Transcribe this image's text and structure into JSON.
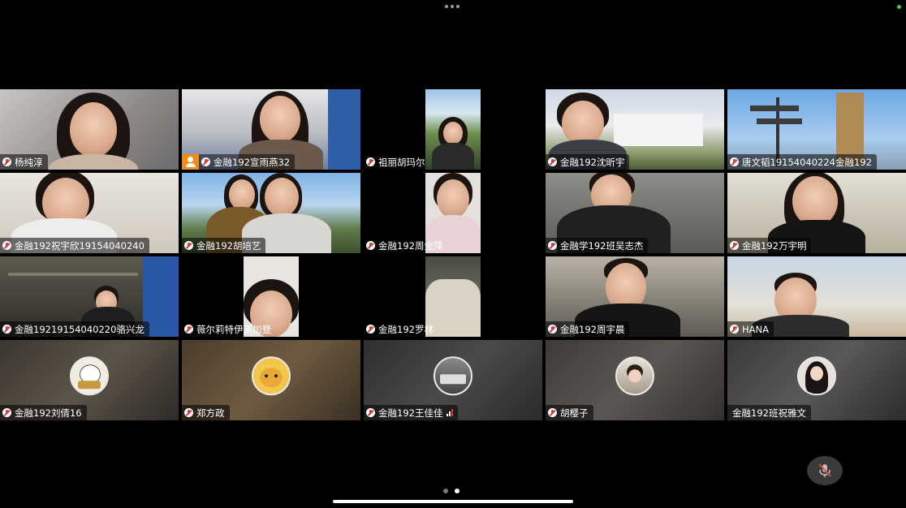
{
  "colors": {
    "background": "#000000",
    "host_badge": "#f08c1a",
    "mic_muted": "#d23b3b",
    "status": "#3ccf4e"
  },
  "participants": [
    {
      "name": "杨纯淳",
      "mic_icon": "muted-mic-icon"
    },
    {
      "name": "金融192宣雨燕32",
      "mic_icon": "muted-mic-icon",
      "host": true
    },
    {
      "name": "祖丽胡玛尔",
      "mic_icon": "muted-mic-icon"
    },
    {
      "name": "金融192沈昕宇",
      "mic_icon": "muted-mic-icon"
    },
    {
      "name": "唐文韬19154040224金融192",
      "mic_icon": "muted-mic-icon"
    },
    {
      "name": "金融192祝宇欣19154040240",
      "mic_icon": "muted-mic-icon"
    },
    {
      "name": "金融192胡培艺",
      "mic_icon": "muted-mic-icon"
    },
    {
      "name": "金融192周金萍",
      "mic_icon": "muted-mic-icon"
    },
    {
      "name": "金融学192班吴志杰",
      "mic_icon": "muted-mic-icon"
    },
    {
      "name": "金融192万宇明",
      "mic_icon": "muted-mic-icon"
    },
    {
      "name": "金融19219154040220骆兴龙",
      "mic_icon": "muted-mic-icon"
    },
    {
      "name": "薇尔莉特伊芙加登",
      "mic_icon": "muted-mic-icon"
    },
    {
      "name": "金融192罗林",
      "mic_icon": "muted-mic-icon"
    },
    {
      "name": "金融192周宇晨",
      "mic_icon": "muted-mic-icon"
    },
    {
      "name": "HANA",
      "mic_icon": "muted-mic-icon"
    },
    {
      "name": "金融192刘倩16",
      "mic_icon": "muted-mic-icon",
      "avatar": "cartoon-avatar"
    },
    {
      "name": "郑方政",
      "mic_icon": "muted-mic-icon",
      "avatar": "bear-avatar"
    },
    {
      "name": "金融192王佳佳",
      "mic_icon": "muted-mic-icon",
      "avatar": "photo-avatar",
      "signal": "signal-bars-icon"
    },
    {
      "name": "胡樱子",
      "mic_icon": "muted-mic-icon",
      "avatar": "photo-avatar"
    },
    {
      "name": "金融192班祝雅文",
      "avatar": "photo-avatar"
    }
  ],
  "controls": {
    "mute_icon": "microphone-muted-icon",
    "page_indicator": {
      "total": 2,
      "active": 2
    }
  }
}
